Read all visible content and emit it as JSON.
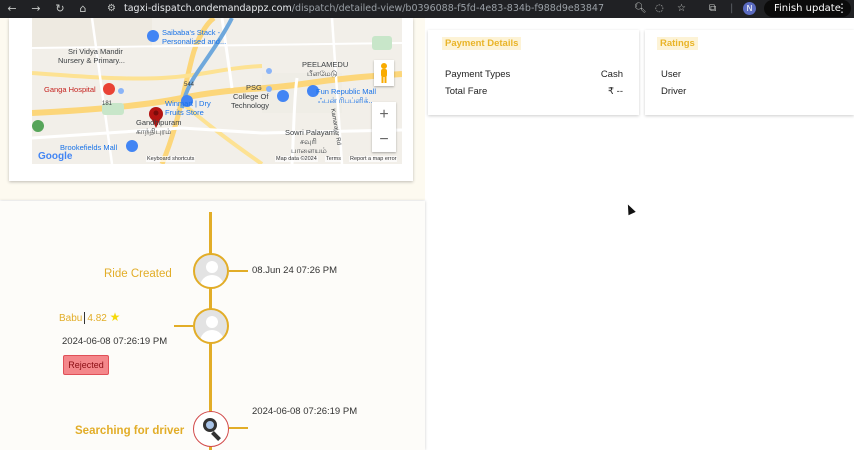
{
  "browser": {
    "url_host": "tagxi-dispatch.ondemandappz.com",
    "url_path": "/dispatch/detailed-view/b0396088-f5fd-4e83-834b-f988d9e83847",
    "avatar_letter": "N",
    "finish_update_label": "Finish update",
    "icons": [
      "back-icon",
      "forward-icon",
      "reload-icon",
      "home-icon",
      "site-info-icon",
      "zoom-icon",
      "eye-off-icon",
      "star-icon",
      "extensions-icon",
      "menu-icon"
    ]
  },
  "map": {
    "labels": {
      "saibaba_stack": "Saibaba's Stack -",
      "personalised": "Personalised and...",
      "sri_vidya_mandir": "Sri Vidya Mandir",
      "nursery": "Nursery & Primary...",
      "ganga_hospital": "Ganga Hospital",
      "winmart": "Winmart | Dry",
      "fruits_store": "Fruits Store",
      "psg": "PSG",
      "college_of": "College Of",
      "technology": "Technology",
      "peelamedu": "PEELAMEDU",
      "peelamedu_tamil": "பீளமேடு",
      "fun_republic": "Fun Republic Mall",
      "fun_republic_tamil": "ஃபன் ரிபப்ளிக்...",
      "gandhipuram": "Gandhipuram",
      "gandhipuram_tamil": "காந்திபுரம்",
      "sowri_palayam": "Sowri Palayam",
      "sowri_tamil_1": "சவுரி",
      "sowri_tamil_2": "பாளையம்",
      "brookefields": "Brookefields Mall",
      "road_181": "181",
      "road_544": "544",
      "kamarajar_road": "Kamarajar Rd"
    },
    "google_logo": "Google",
    "keyboard_shortcuts": "Keyboard shortcuts",
    "map_data": "Map data ©2024",
    "terms": "Terms",
    "report": "Report a map error",
    "zoom_in": "+",
    "zoom_out": "−"
  },
  "payment_details": {
    "title": "Payment Details",
    "payment_types_label": "Payment Types",
    "payment_types_value": "Cash",
    "total_fare_label": "Total Fare",
    "total_fare_value": "₹ --"
  },
  "ratings": {
    "title": "Ratings",
    "user_label": "User",
    "driver_label": "Driver"
  },
  "timeline": {
    "ride_created_title": "Ride Created",
    "ride_created_time": "08.Jun 24 07:26 PM",
    "driver_name": "Babu",
    "driver_rating": "4.82",
    "driver_time": "2024-06-08 07:26:19 PM",
    "driver_status": "Rejected",
    "searching_time": "2024-06-08 07:26:19 PM",
    "searching_title": "Searching for driver"
  },
  "colors": {
    "accent": "#e2ad28",
    "rejected_bg": "#f4878b",
    "chrome_bg": "#202124"
  }
}
